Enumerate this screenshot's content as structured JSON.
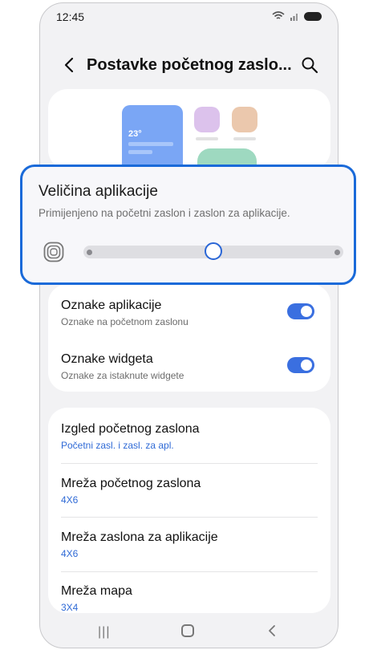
{
  "status_bar": {
    "time": "12:45"
  },
  "header": {
    "title": "Postavke početnog zaslo..."
  },
  "preview": {
    "weather_temp": "23°"
  },
  "popup": {
    "title": "Veličina aplikacije",
    "subtitle": "Primijenjeno na početni zaslon i zaslon za aplikacije.",
    "slider": {
      "value_fraction": 0.5,
      "steps": 3
    }
  },
  "toggles": [
    {
      "title": "Oznake aplikacije",
      "subtitle": "Oznake na početnom zaslonu",
      "on": true
    },
    {
      "title": "Oznake widgeta",
      "subtitle": "Oznake za istaknute widgete",
      "on": true
    }
  ],
  "settings_list": [
    {
      "title": "Izgled početnog zaslona",
      "value": "Početni zasl. i zasl. za apl."
    },
    {
      "title": "Mreža početnog zaslona",
      "value": "4X6"
    },
    {
      "title": "Mreža zaslona za aplikacije",
      "value": "4X6"
    },
    {
      "title": "Mreža mapa",
      "value": "3X4"
    }
  ],
  "colors": {
    "accent": "#1a6ad9",
    "toggle_on": "#3a6fe0",
    "link_value": "#2f6ad6"
  },
  "icons": [
    "wifi-icon",
    "signal-icon",
    "battery-icon",
    "back-arrow-icon",
    "search-icon",
    "app-size-icon",
    "nav-recents-icon",
    "nav-home-icon",
    "nav-back-icon"
  ]
}
